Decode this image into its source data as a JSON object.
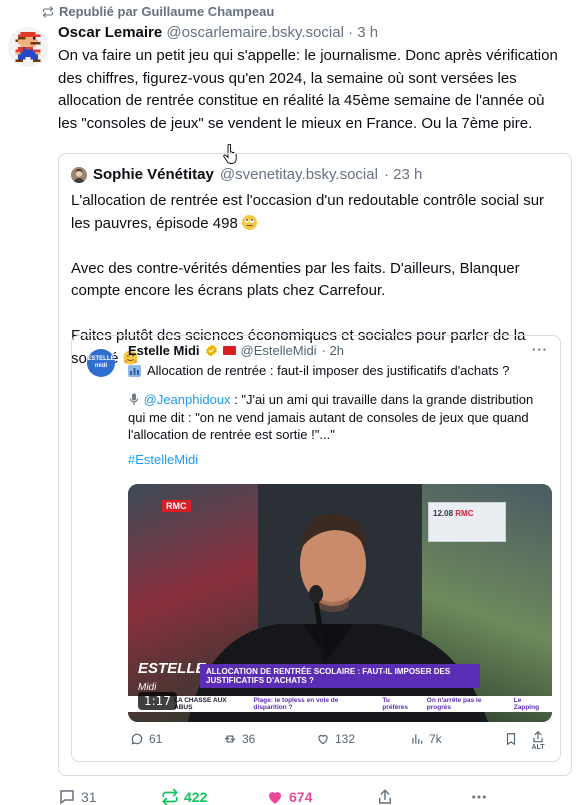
{
  "repost_line": {
    "label": "Republié par Guillaume Champeau"
  },
  "post": {
    "author_name": "Oscar Lemaire",
    "author_handle": "@oscarlemaire.bsky.social",
    "time": "· 3 h",
    "text": "On va faire un petit jeu qui s'appelle: le journalisme. Donc après vérification des chiffres, figurez-vous qu'en 2024, la semaine où sont versées les allocation de rentrée constitue en réalité la 45ème semaine de l'année où les \"consoles de jeux\" se vendent le mieux en France. Ou la 7ème pire."
  },
  "quote": {
    "author_name": "Sophie Vénétitay",
    "author_handle": "@svenetitay.bsky.social",
    "time": "· 23 h",
    "para1": "L'allocation de rentrée est l'occasion d'un redoutable contrôle social sur les pauvres, épisode 498",
    "para2": "Avec des contre-vérités démenties par les faits. D'ailleurs, Blanquer compte encore les écrans plats chez Carrefour.",
    "para3": "Faites plutôt des sciences économiques et sociales pour parler de la société"
  },
  "embedded": {
    "logo_text": "ESTELLE midi",
    "author_name": "Estelle Midi",
    "author_handle": "@EstelleMidi",
    "time": "· 2h",
    "more": "···",
    "title": "Allocation de rentrée : faut-il imposer des justificatifs d'achats ?",
    "mention": "@Jeanphidoux",
    "quote_text": " : \"J'ai un ami qui travaille dans la grande distribution qui me dit : \"on ne vend jamais autant de consoles de jeux que quand l'allocation de rentrée est sortie !\"...\"",
    "hashtag": "#EstelleMidi",
    "video": {
      "duration": "1:17",
      "channel_tag": "RMC",
      "screen_time": "12.08",
      "screen_channel": "RMC",
      "show_logo": "ESTELLE",
      "show_logo_sub": "Midi",
      "chyron_text": "ALLOCATION DE RENTRÉE SCOLAIRE : FAUT-IL IMPOSER DES JUSTIFICATIFS D'ACHATS ?",
      "ticker": [
        "LA CHASSE AUX ABUS",
        "Plage: le topless en voie de disparition ?",
        "Tu préfères",
        "On n'arrête pas le progrès",
        "Le Zapping"
      ]
    },
    "stats": {
      "replies": "61",
      "retweets": "36",
      "likes": "132",
      "views": "7k",
      "alt": "ALT"
    }
  },
  "actions": {
    "replies": "31",
    "reposts": "422",
    "likes": "674"
  },
  "colors": {
    "text": "#0b0f14",
    "muted": "#66727f",
    "link": "#1d9bf0",
    "repost_green": "#13c25b",
    "like_pink": "#ec4899",
    "border": "#d4dbe2"
  }
}
